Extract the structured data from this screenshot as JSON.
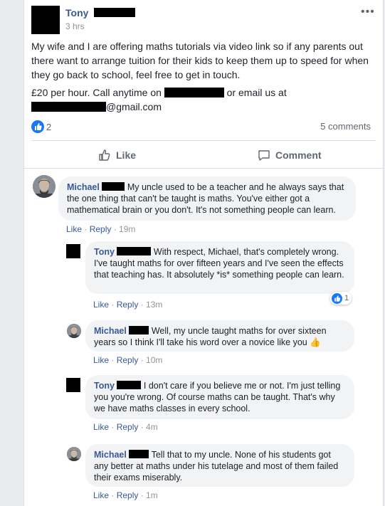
{
  "post": {
    "author_first": "Tony",
    "time": "3 hrs",
    "more_icon": "more-dots",
    "body_p1": "My wife and I are offering maths tutorials via video link so if any parents out there want to arrange tuition for their kids to keep them up to speed for when they go back to school, feel free to get in touch.",
    "body_p2a": "£20 per hour. Call anytime on",
    "body_p2b": "or email us at",
    "email_suffix": "@gmail.com",
    "reaction_count": "2",
    "comments_count": "5 comments",
    "like_label": "Like",
    "comment_label": "Comment"
  },
  "comments": [
    {
      "name": "Michael",
      "text": "My uncle used to be a teacher and he always says that the one thing that can't be taught is maths. You've either got a mathematical brain or you don't. It's not something people can learn.",
      "like": "Like",
      "reply": "Reply",
      "time": "19m"
    },
    {
      "name": "Tony",
      "text": "With respect, Michael, that's completely wrong. I've taught maths for over fifteen years and I've seen the effects that teaching has. It absolutely *is* something people can learn.",
      "like": "Like",
      "reply": "Reply",
      "time": "13m",
      "reaction_count": "1"
    },
    {
      "name": "Michael",
      "text": "Well, my uncle taught maths for over sixteen years so I think I'll take his word over a novice like you",
      "emoji": "👍",
      "like": "Like",
      "reply": "Reply",
      "time": "10m"
    },
    {
      "name": "Tony",
      "text": "I don't care if you believe me or not. I'm just telling you you're wrong. Of course maths can be taught. That's why we have maths classes in every school.",
      "like": "Like",
      "reply": "Reply",
      "time": "4m"
    },
    {
      "name": "Michael",
      "text": "Tell that to my uncle. None of his students got any better at maths under his tutelage and most of them failed their exams miserably.",
      "like": "Like",
      "reply": "Reply",
      "time": "1m"
    }
  ],
  "colors": {
    "link": "#385898",
    "bubble": "#f2f3f5",
    "like_blue": "#1877f2",
    "meta": "#90949c"
  }
}
